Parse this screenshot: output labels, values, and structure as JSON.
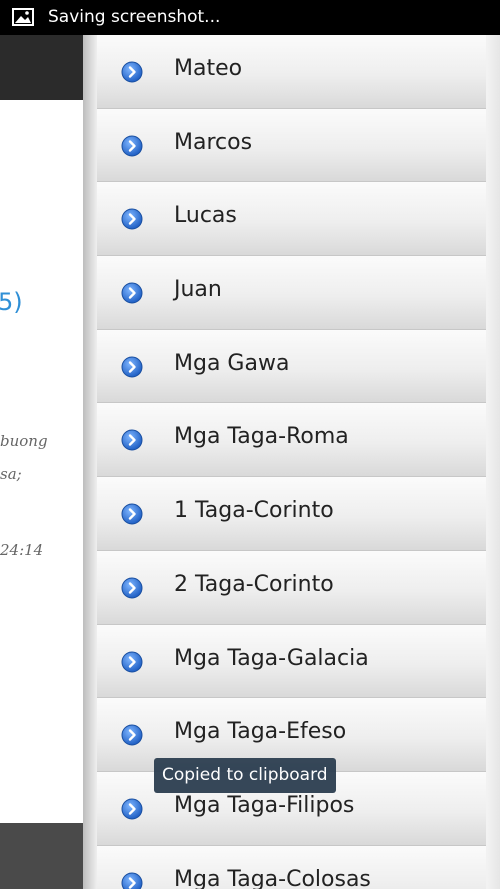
{
  "status_bar": {
    "notification_icon": "image-icon",
    "text": "Saving screenshot..."
  },
  "background_page": {
    "reference_fragment": "5)",
    "text_line_1": "buong",
    "text_line_2": "sa;",
    "text_line_3": "24:14"
  },
  "drawer": {
    "item_icon": "chevron-right-circle-icon",
    "items": [
      {
        "label": "Mateo"
      },
      {
        "label": "Marcos"
      },
      {
        "label": "Lucas"
      },
      {
        "label": "Juan"
      },
      {
        "label": "Mga Gawa"
      },
      {
        "label": "Mga Taga-Roma"
      },
      {
        "label": "1 Taga-Corinto"
      },
      {
        "label": "2 Taga-Corinto"
      },
      {
        "label": "Mga Taga-Galacia"
      },
      {
        "label": "Mga Taga-Efeso"
      },
      {
        "label": "Mga Taga-Filipos"
      },
      {
        "label": "Mga Taga-Colosas"
      }
    ]
  },
  "toast": {
    "text": "Copied to clipboard"
  },
  "colors": {
    "accent": "#2f8fd6",
    "icon_blue": "#2a6fd1",
    "toast_bg": "#2c3e50"
  }
}
